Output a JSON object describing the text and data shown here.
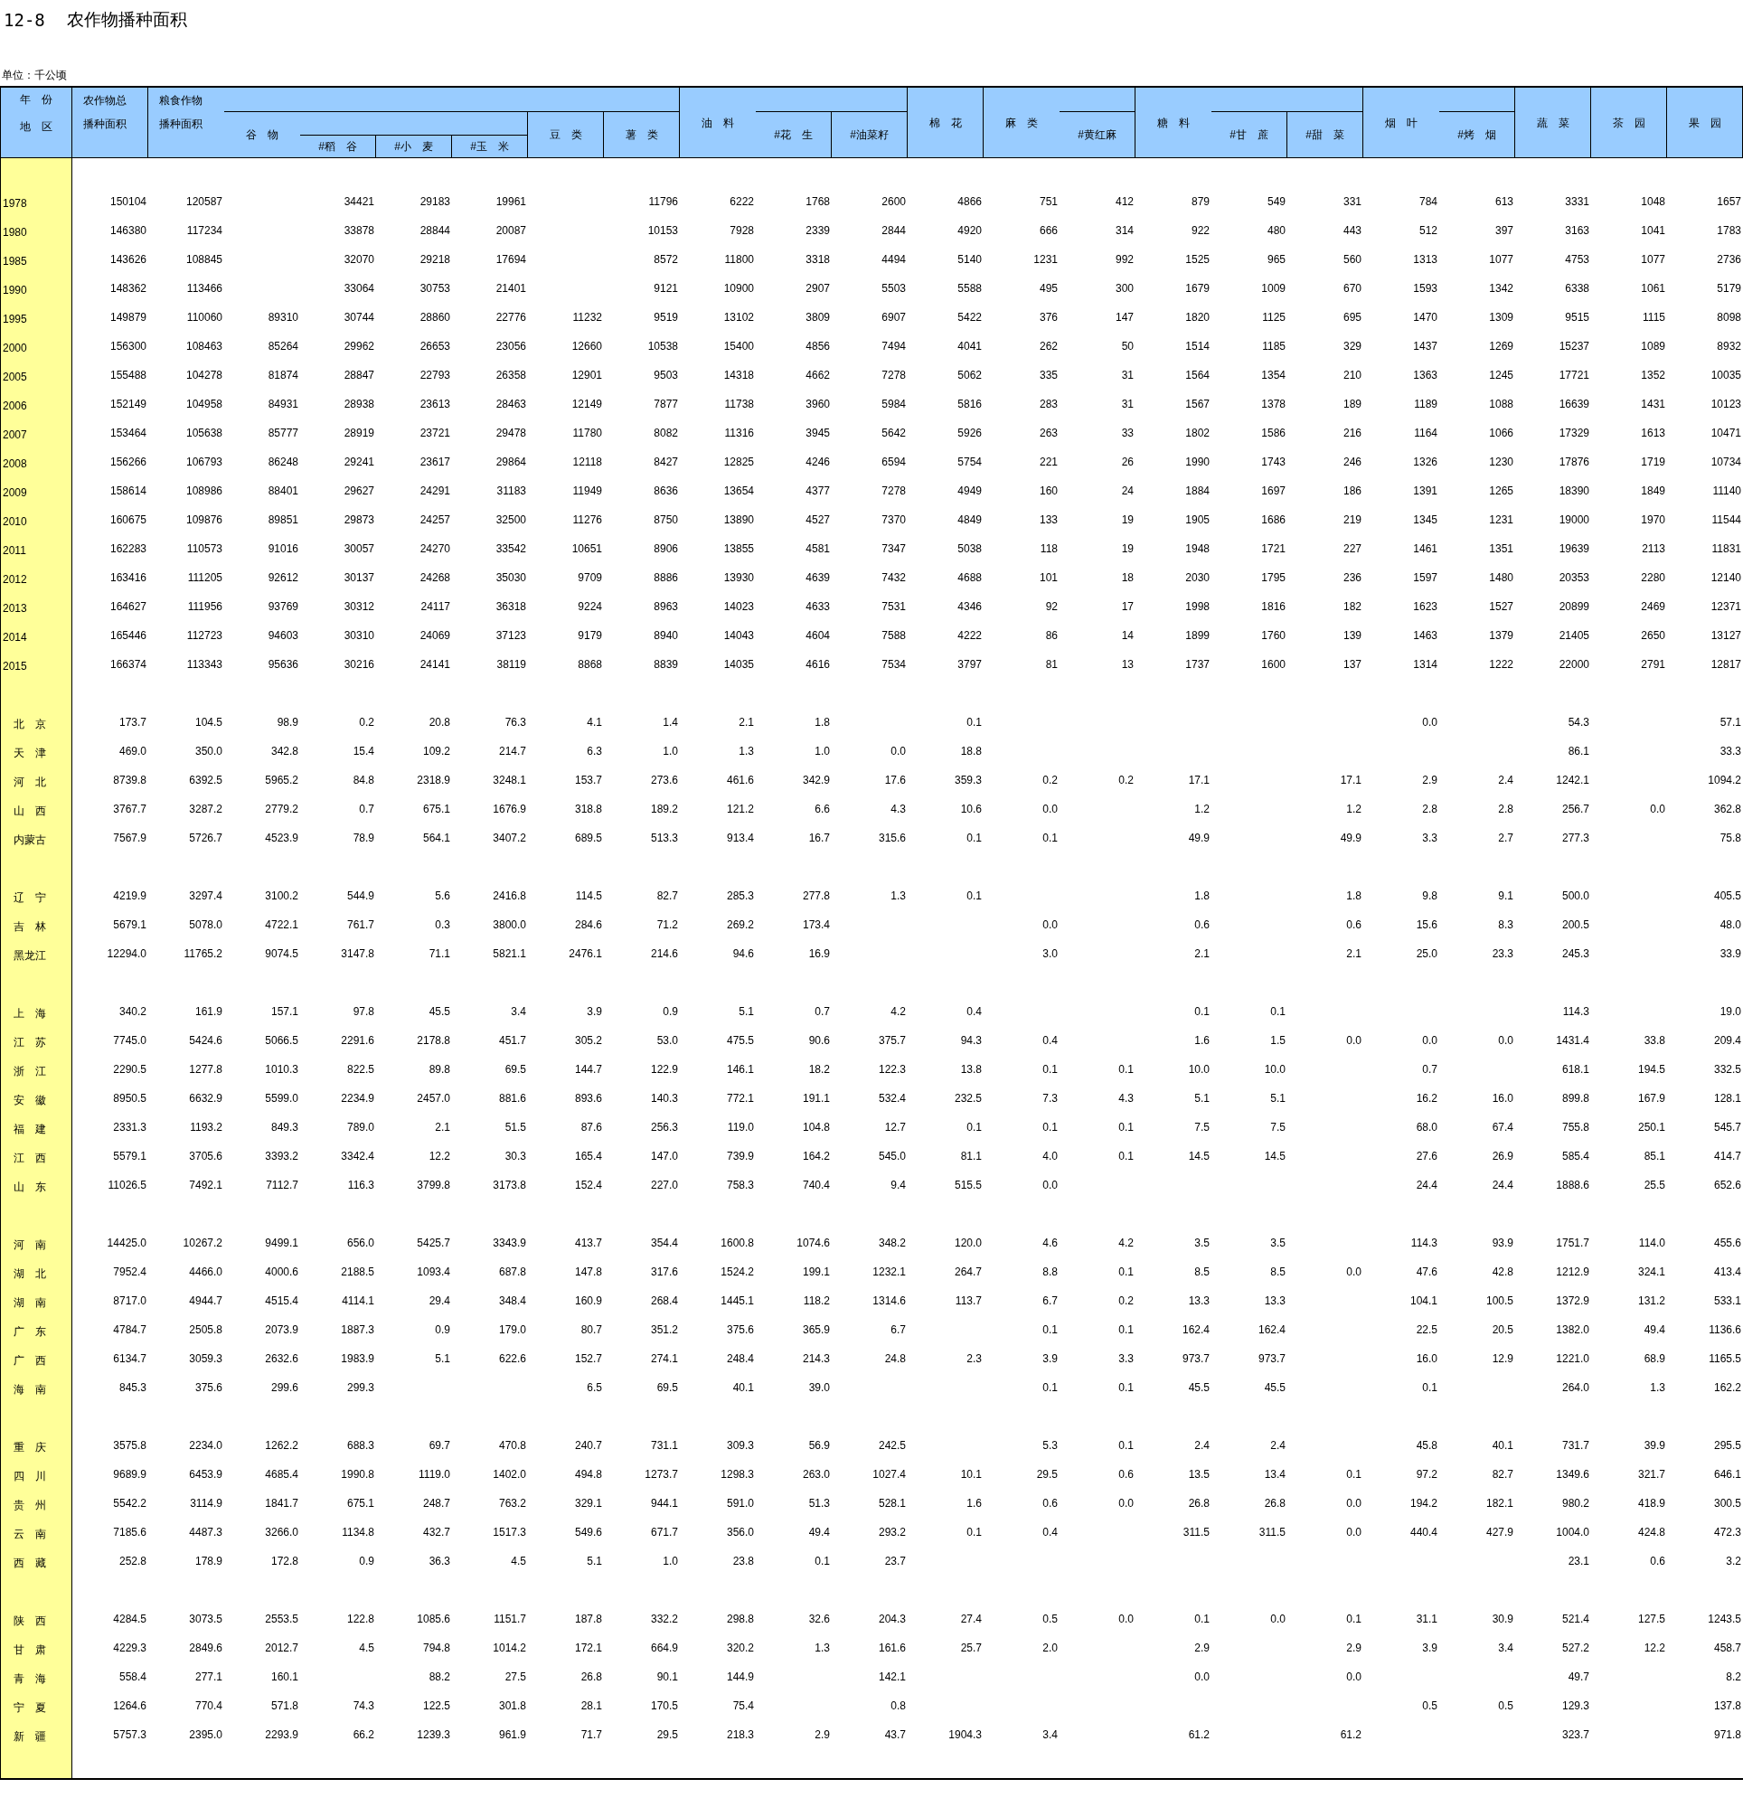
{
  "title": {
    "number": "12-8",
    "text": "农作物播种面积"
  },
  "unit": "单位：千公顷",
  "header": {
    "corner": [
      "年　份",
      "地　区"
    ],
    "columns": [
      {
        "lines": [
          "农作物总",
          "播种面积"
        ]
      },
      {
        "lines": [
          "粮食作物",
          "播种面积"
        ],
        "children": [
          {
            "lines": [
              "谷　物"
            ],
            "children": [
              {
                "lines": [
                  "#稻　谷"
                ]
              },
              {
                "lines": [
                  "#小　麦"
                ]
              },
              {
                "lines": [
                  "#玉　米"
                ]
              }
            ]
          },
          {
            "lines": [
              "豆　类"
            ]
          },
          {
            "lines": [
              "薯　类"
            ]
          }
        ]
      },
      {
        "lines": [
          "油　料"
        ],
        "children": [
          {
            "lines": [
              "#花　生"
            ]
          },
          {
            "lines": [
              "#油菜籽"
            ]
          }
        ]
      },
      {
        "lines": [
          "棉　花"
        ]
      },
      {
        "lines": [
          "麻　类"
        ],
        "children": [
          {
            "lines": [
              "#黄红麻"
            ]
          }
        ]
      },
      {
        "lines": [
          "糖　料"
        ],
        "children": [
          {
            "lines": [
              "#甘　蔗"
            ]
          },
          {
            "lines": [
              "#甜　菜"
            ]
          }
        ]
      },
      {
        "lines": [
          "烟　叶"
        ],
        "children": [
          {
            "lines": [
              "#烤　烟"
            ]
          }
        ]
      },
      {
        "lines": [
          "蔬　菜"
        ]
      },
      {
        "lines": [
          "茶　园"
        ]
      },
      {
        "lines": [
          "果　园"
        ]
      }
    ]
  },
  "years": [
    {
      "label": "1978",
      "cells": [
        "150104",
        "120587",
        null,
        "34421",
        "29183",
        "19961",
        null,
        "11796",
        "6222",
        "1768",
        "2600",
        "4866",
        "751",
        "412",
        "879",
        "549",
        "331",
        "784",
        "613",
        "3331",
        "1048",
        "1657"
      ]
    },
    {
      "label": "1980",
      "cells": [
        "146380",
        "117234",
        null,
        "33878",
        "28844",
        "20087",
        null,
        "10153",
        "7928",
        "2339",
        "2844",
        "4920",
        "666",
        "314",
        "922",
        "480",
        "443",
        "512",
        "397",
        "3163",
        "1041",
        "1783"
      ]
    },
    {
      "label": "1985",
      "cells": [
        "143626",
        "108845",
        null,
        "32070",
        "29218",
        "17694",
        null,
        "8572",
        "11800",
        "3318",
        "4494",
        "5140",
        "1231",
        "992",
        "1525",
        "965",
        "560",
        "1313",
        "1077",
        "4753",
        "1077",
        "2736"
      ]
    },
    {
      "label": "1990",
      "cells": [
        "148362",
        "113466",
        null,
        "33064",
        "30753",
        "21401",
        null,
        "9121",
        "10900",
        "2907",
        "5503",
        "5588",
        "495",
        "300",
        "1679",
        "1009",
        "670",
        "1593",
        "1342",
        "6338",
        "1061",
        "5179"
      ]
    },
    {
      "label": "1995",
      "cells": [
        "149879",
        "110060",
        "89310",
        "30744",
        "28860",
        "22776",
        "11232",
        "9519",
        "13102",
        "3809",
        "6907",
        "5422",
        "376",
        "147",
        "1820",
        "1125",
        "695",
        "1470",
        "1309",
        "9515",
        "1115",
        "8098"
      ]
    },
    {
      "label": "2000",
      "cells": [
        "156300",
        "108463",
        "85264",
        "29962",
        "26653",
        "23056",
        "12660",
        "10538",
        "15400",
        "4856",
        "7494",
        "4041",
        "262",
        "50",
        "1514",
        "1185",
        "329",
        "1437",
        "1269",
        "15237",
        "1089",
        "8932"
      ]
    },
    {
      "label": "2005",
      "cells": [
        "155488",
        "104278",
        "81874",
        "28847",
        "22793",
        "26358",
        "12901",
        "9503",
        "14318",
        "4662",
        "7278",
        "5062",
        "335",
        "31",
        "1564",
        "1354",
        "210",
        "1363",
        "1245",
        "17721",
        "1352",
        "10035"
      ]
    },
    {
      "label": "2006",
      "cells": [
        "152149",
        "104958",
        "84931",
        "28938",
        "23613",
        "28463",
        "12149",
        "7877",
        "11738",
        "3960",
        "5984",
        "5816",
        "283",
        "31",
        "1567",
        "1378",
        "189",
        "1189",
        "1088",
        "16639",
        "1431",
        "10123"
      ]
    },
    {
      "label": "2007",
      "cells": [
        "153464",
        "105638",
        "85777",
        "28919",
        "23721",
        "29478",
        "11780",
        "8082",
        "11316",
        "3945",
        "5642",
        "5926",
        "263",
        "33",
        "1802",
        "1586",
        "216",
        "1164",
        "1066",
        "17329",
        "1613",
        "10471"
      ]
    },
    {
      "label": "2008",
      "cells": [
        "156266",
        "106793",
        "86248",
        "29241",
        "23617",
        "29864",
        "12118",
        "8427",
        "12825",
        "4246",
        "6594",
        "5754",
        "221",
        "26",
        "1990",
        "1743",
        "246",
        "1326",
        "1230",
        "17876",
        "1719",
        "10734"
      ]
    },
    {
      "label": "2009",
      "cells": [
        "158614",
        "108986",
        "88401",
        "29627",
        "24291",
        "31183",
        "11949",
        "8636",
        "13654",
        "4377",
        "7278",
        "4949",
        "160",
        "24",
        "1884",
        "1697",
        "186",
        "1391",
        "1265",
        "18390",
        "1849",
        "11140"
      ]
    },
    {
      "label": "2010",
      "cells": [
        "160675",
        "109876",
        "89851",
        "29873",
        "24257",
        "32500",
        "11276",
        "8750",
        "13890",
        "4527",
        "7370",
        "4849",
        "133",
        "19",
        "1905",
        "1686",
        "219",
        "1345",
        "1231",
        "19000",
        "1970",
        "11544"
      ]
    },
    {
      "label": "2011",
      "cells": [
        "162283",
        "110573",
        "91016",
        "30057",
        "24270",
        "33542",
        "10651",
        "8906",
        "13855",
        "4581",
        "7347",
        "5038",
        "118",
        "19",
        "1948",
        "1721",
        "227",
        "1461",
        "1351",
        "19639",
        "2113",
        "11831"
      ]
    },
    {
      "label": "2012",
      "cells": [
        "163416",
        "111205",
        "92612",
        "30137",
        "24268",
        "35030",
        "9709",
        "8886",
        "13930",
        "4639",
        "7432",
        "4688",
        "101",
        "18",
        "2030",
        "1795",
        "236",
        "1597",
        "1480",
        "20353",
        "2280",
        "12140"
      ]
    },
    {
      "label": "2013",
      "cells": [
        "164627",
        "111956",
        "93769",
        "30312",
        "24117",
        "36318",
        "9224",
        "8963",
        "14023",
        "4633",
        "7531",
        "4346",
        "92",
        "17",
        "1998",
        "1816",
        "182",
        "1623",
        "1527",
        "20899",
        "2469",
        "12371"
      ]
    },
    {
      "label": "2014",
      "cells": [
        "165446",
        "112723",
        "94603",
        "30310",
        "24069",
        "37123",
        "9179",
        "8940",
        "14043",
        "4604",
        "7588",
        "4222",
        "86",
        "14",
        "1899",
        "1760",
        "139",
        "1463",
        "1379",
        "21405",
        "2650",
        "13127"
      ]
    },
    {
      "label": "2015",
      "cells": [
        "166374",
        "113343",
        "95636",
        "30216",
        "24141",
        "38119",
        "8868",
        "8839",
        "14035",
        "4616",
        "7534",
        "3797",
        "81",
        "13",
        "1737",
        "1600",
        "137",
        "1314",
        "1222",
        "22000",
        "2791",
        "12817"
      ]
    }
  ],
  "region_groups": [
    [
      {
        "label": "北　京",
        "cells": [
          "173.7",
          "104.5",
          "98.9",
          "0.2",
          "20.8",
          "76.3",
          "4.1",
          "1.4",
          "2.1",
          "1.8",
          null,
          "0.1",
          null,
          null,
          null,
          null,
          null,
          "0.0",
          null,
          "54.3",
          null,
          "57.1"
        ]
      },
      {
        "label": "天　津",
        "cells": [
          "469.0",
          "350.0",
          "342.8",
          "15.4",
          "109.2",
          "214.7",
          "6.3",
          "1.0",
          "1.3",
          "1.0",
          "0.0",
          "18.8",
          null,
          null,
          null,
          null,
          null,
          null,
          null,
          "86.1",
          null,
          "33.3"
        ]
      },
      {
        "label": "河　北",
        "cells": [
          "8739.8",
          "6392.5",
          "5965.2",
          "84.8",
          "2318.9",
          "3248.1",
          "153.7",
          "273.6",
          "461.6",
          "342.9",
          "17.6",
          "359.3",
          "0.2",
          "0.2",
          "17.1",
          null,
          "17.1",
          "2.9",
          "2.4",
          "1242.1",
          null,
          "1094.2"
        ]
      },
      {
        "label": "山　西",
        "cells": [
          "3767.7",
          "3287.2",
          "2779.2",
          "0.7",
          "675.1",
          "1676.9",
          "318.8",
          "189.2",
          "121.2",
          "6.6",
          "4.3",
          "10.6",
          "0.0",
          null,
          "1.2",
          null,
          "1.2",
          "2.8",
          "2.8",
          "256.7",
          "0.0",
          "362.8"
        ]
      },
      {
        "label": "内蒙古",
        "cells": [
          "7567.9",
          "5726.7",
          "4523.9",
          "78.9",
          "564.1",
          "3407.2",
          "689.5",
          "513.3",
          "913.4",
          "16.7",
          "315.6",
          "0.1",
          "0.1",
          null,
          "49.9",
          null,
          "49.9",
          "3.3",
          "2.7",
          "277.3",
          null,
          "75.8"
        ]
      }
    ],
    [
      {
        "label": "辽　宁",
        "cells": [
          "4219.9",
          "3297.4",
          "3100.2",
          "544.9",
          "5.6",
          "2416.8",
          "114.5",
          "82.7",
          "285.3",
          "277.8",
          "1.3",
          "0.1",
          null,
          null,
          "1.8",
          null,
          "1.8",
          "9.8",
          "9.1",
          "500.0",
          null,
          "405.5"
        ]
      },
      {
        "label": "吉　林",
        "cells": [
          "5679.1",
          "5078.0",
          "4722.1",
          "761.7",
          "0.3",
          "3800.0",
          "284.6",
          "71.2",
          "269.2",
          "173.4",
          null,
          null,
          "0.0",
          null,
          "0.6",
          null,
          "0.6",
          "15.6",
          "8.3",
          "200.5",
          null,
          "48.0"
        ]
      },
      {
        "label": "黑龙江",
        "cells": [
          "12294.0",
          "11765.2",
          "9074.5",
          "3147.8",
          "71.1",
          "5821.1",
          "2476.1",
          "214.6",
          "94.6",
          "16.9",
          null,
          null,
          "3.0",
          null,
          "2.1",
          null,
          "2.1",
          "25.0",
          "23.3",
          "245.3",
          null,
          "33.9"
        ]
      }
    ],
    [
      {
        "label": "上　海",
        "cells": [
          "340.2",
          "161.9",
          "157.1",
          "97.8",
          "45.5",
          "3.4",
          "3.9",
          "0.9",
          "5.1",
          "0.7",
          "4.2",
          "0.4",
          null,
          null,
          "0.1",
          "0.1",
          null,
          null,
          null,
          "114.3",
          null,
          "19.0"
        ]
      },
      {
        "label": "江　苏",
        "cells": [
          "7745.0",
          "5424.6",
          "5066.5",
          "2291.6",
          "2178.8",
          "451.7",
          "305.2",
          "53.0",
          "475.5",
          "90.6",
          "375.7",
          "94.3",
          "0.4",
          null,
          "1.6",
          "1.5",
          "0.0",
          "0.0",
          "0.0",
          "1431.4",
          "33.8",
          "209.4"
        ]
      },
      {
        "label": "浙　江",
        "cells": [
          "2290.5",
          "1277.8",
          "1010.3",
          "822.5",
          "89.8",
          "69.5",
          "144.7",
          "122.9",
          "146.1",
          "18.2",
          "122.3",
          "13.8",
          "0.1",
          "0.1",
          "10.0",
          "10.0",
          null,
          "0.7",
          null,
          "618.1",
          "194.5",
          "332.5"
        ]
      },
      {
        "label": "安　徽",
        "cells": [
          "8950.5",
          "6632.9",
          "5599.0",
          "2234.9",
          "2457.0",
          "881.6",
          "893.6",
          "140.3",
          "772.1",
          "191.1",
          "532.4",
          "232.5",
          "7.3",
          "4.3",
          "5.1",
          "5.1",
          null,
          "16.2",
          "16.0",
          "899.8",
          "167.9",
          "128.1"
        ]
      },
      {
        "label": "福　建",
        "cells": [
          "2331.3",
          "1193.2",
          "849.3",
          "789.0",
          "2.1",
          "51.5",
          "87.6",
          "256.3",
          "119.0",
          "104.8",
          "12.7",
          "0.1",
          "0.1",
          "0.1",
          "7.5",
          "7.5",
          null,
          "68.0",
          "67.4",
          "755.8",
          "250.1",
          "545.7"
        ]
      },
      {
        "label": "江　西",
        "cells": [
          "5579.1",
          "3705.6",
          "3393.2",
          "3342.4",
          "12.2",
          "30.3",
          "165.4",
          "147.0",
          "739.9",
          "164.2",
          "545.0",
          "81.1",
          "4.0",
          "0.1",
          "14.5",
          "14.5",
          null,
          "27.6",
          "26.9",
          "585.4",
          "85.1",
          "414.7"
        ]
      },
      {
        "label": "山　东",
        "cells": [
          "11026.5",
          "7492.1",
          "7112.7",
          "116.3",
          "3799.8",
          "3173.8",
          "152.4",
          "227.0",
          "758.3",
          "740.4",
          "9.4",
          "515.5",
          "0.0",
          null,
          null,
          null,
          null,
          "24.4",
          "24.4",
          "1888.6",
          "25.5",
          "652.6"
        ]
      }
    ],
    [
      {
        "label": "河　南",
        "cells": [
          "14425.0",
          "10267.2",
          "9499.1",
          "656.0",
          "5425.7",
          "3343.9",
          "413.7",
          "354.4",
          "1600.8",
          "1074.6",
          "348.2",
          "120.0",
          "4.6",
          "4.2",
          "3.5",
          "3.5",
          null,
          "114.3",
          "93.9",
          "1751.7",
          "114.0",
          "455.6"
        ]
      },
      {
        "label": "湖　北",
        "cells": [
          "7952.4",
          "4466.0",
          "4000.6",
          "2188.5",
          "1093.4",
          "687.8",
          "147.8",
          "317.6",
          "1524.2",
          "199.1",
          "1232.1",
          "264.7",
          "8.8",
          "0.1",
          "8.5",
          "8.5",
          "0.0",
          "47.6",
          "42.8",
          "1212.9",
          "324.1",
          "413.4"
        ]
      },
      {
        "label": "湖　南",
        "cells": [
          "8717.0",
          "4944.7",
          "4515.4",
          "4114.1",
          "29.4",
          "348.4",
          "160.9",
          "268.4",
          "1445.1",
          "118.2",
          "1314.6",
          "113.7",
          "6.7",
          "0.2",
          "13.3",
          "13.3",
          null,
          "104.1",
          "100.5",
          "1372.9",
          "131.2",
          "533.1"
        ]
      },
      {
        "label": "广　东",
        "cells": [
          "4784.7",
          "2505.8",
          "2073.9",
          "1887.3",
          "0.9",
          "179.0",
          "80.7",
          "351.2",
          "375.6",
          "365.9",
          "6.7",
          null,
          "0.1",
          "0.1",
          "162.4",
          "162.4",
          null,
          "22.5",
          "20.5",
          "1382.0",
          "49.4",
          "1136.6"
        ]
      },
      {
        "label": "广　西",
        "cells": [
          "6134.7",
          "3059.3",
          "2632.6",
          "1983.9",
          "5.1",
          "622.6",
          "152.7",
          "274.1",
          "248.4",
          "214.3",
          "24.8",
          "2.3",
          "3.9",
          "3.3",
          "973.7",
          "973.7",
          null,
          "16.0",
          "12.9",
          "1221.0",
          "68.9",
          "1165.5"
        ]
      },
      {
        "label": "海　南",
        "cells": [
          "845.3",
          "375.6",
          "299.6",
          "299.3",
          null,
          null,
          "6.5",
          "69.5",
          "40.1",
          "39.0",
          null,
          null,
          "0.1",
          "0.1",
          "45.5",
          "45.5",
          null,
          "0.1",
          null,
          "264.0",
          "1.3",
          "162.2"
        ]
      }
    ],
    [
      {
        "label": "重　庆",
        "cells": [
          "3575.8",
          "2234.0",
          "1262.2",
          "688.3",
          "69.7",
          "470.8",
          "240.7",
          "731.1",
          "309.3",
          "56.9",
          "242.5",
          null,
          "5.3",
          "0.1",
          "2.4",
          "2.4",
          null,
          "45.8",
          "40.1",
          "731.7",
          "39.9",
          "295.5"
        ]
      },
      {
        "label": "四　川",
        "cells": [
          "9689.9",
          "6453.9",
          "4685.4",
          "1990.8",
          "1119.0",
          "1402.0",
          "494.8",
          "1273.7",
          "1298.3",
          "263.0",
          "1027.4",
          "10.1",
          "29.5",
          "0.6",
          "13.5",
          "13.4",
          "0.1",
          "97.2",
          "82.7",
          "1349.6",
          "321.7",
          "646.1"
        ]
      },
      {
        "label": "贵　州",
        "cells": [
          "5542.2",
          "3114.9",
          "1841.7",
          "675.1",
          "248.7",
          "763.2",
          "329.1",
          "944.1",
          "591.0",
          "51.3",
          "528.1",
          "1.6",
          "0.6",
          "0.0",
          "26.8",
          "26.8",
          "0.0",
          "194.2",
          "182.1",
          "980.2",
          "418.9",
          "300.5"
        ]
      },
      {
        "label": "云　南",
        "cells": [
          "7185.6",
          "4487.3",
          "3266.0",
          "1134.8",
          "432.7",
          "1517.3",
          "549.6",
          "671.7",
          "356.0",
          "49.4",
          "293.2",
          "0.1",
          "0.4",
          null,
          "311.5",
          "311.5",
          "0.0",
          "440.4",
          "427.9",
          "1004.0",
          "424.8",
          "472.3"
        ]
      },
      {
        "label": "西　藏",
        "cells": [
          "252.8",
          "178.9",
          "172.8",
          "0.9",
          "36.3",
          "4.5",
          "5.1",
          "1.0",
          "23.8",
          "0.1",
          "23.7",
          null,
          null,
          null,
          null,
          null,
          null,
          null,
          null,
          "23.1",
          "0.6",
          "3.2"
        ]
      }
    ],
    [
      {
        "label": "陕　西",
        "cells": [
          "4284.5",
          "3073.5",
          "2553.5",
          "122.8",
          "1085.6",
          "1151.7",
          "187.8",
          "332.2",
          "298.8",
          "32.6",
          "204.3",
          "27.4",
          "0.5",
          "0.0",
          "0.1",
          "0.0",
          "0.1",
          "31.1",
          "30.9",
          "521.4",
          "127.5",
          "1243.5"
        ]
      },
      {
        "label": "甘　肃",
        "cells": [
          "4229.3",
          "2849.6",
          "2012.7",
          "4.5",
          "794.8",
          "1014.2",
          "172.1",
          "664.9",
          "320.2",
          "1.3",
          "161.6",
          "25.7",
          "2.0",
          null,
          "2.9",
          null,
          "2.9",
          "3.9",
          "3.4",
          "527.2",
          "12.2",
          "458.7"
        ]
      },
      {
        "label": "青　海",
        "cells": [
          "558.4",
          "277.1",
          "160.1",
          null,
          "88.2",
          "27.5",
          "26.8",
          "90.1",
          "144.9",
          null,
          "142.1",
          null,
          null,
          null,
          "0.0",
          null,
          "0.0",
          null,
          null,
          "49.7",
          null,
          "8.2"
        ]
      },
      {
        "label": "宁　夏",
        "cells": [
          "1264.6",
          "770.4",
          "571.8",
          "74.3",
          "122.5",
          "301.8",
          "28.1",
          "170.5",
          "75.4",
          null,
          "0.8",
          null,
          null,
          null,
          null,
          null,
          null,
          "0.5",
          "0.5",
          "129.3",
          null,
          "137.8"
        ]
      },
      {
        "label": "新　疆",
        "cells": [
          "5757.3",
          "2395.0",
          "2293.9",
          "66.2",
          "1239.3",
          "961.9",
          "71.7",
          "29.5",
          "218.3",
          "2.9",
          "43.7",
          "1904.3",
          "3.4",
          null,
          "61.2",
          null,
          "61.2",
          null,
          null,
          "323.7",
          null,
          "971.8"
        ]
      }
    ]
  ]
}
